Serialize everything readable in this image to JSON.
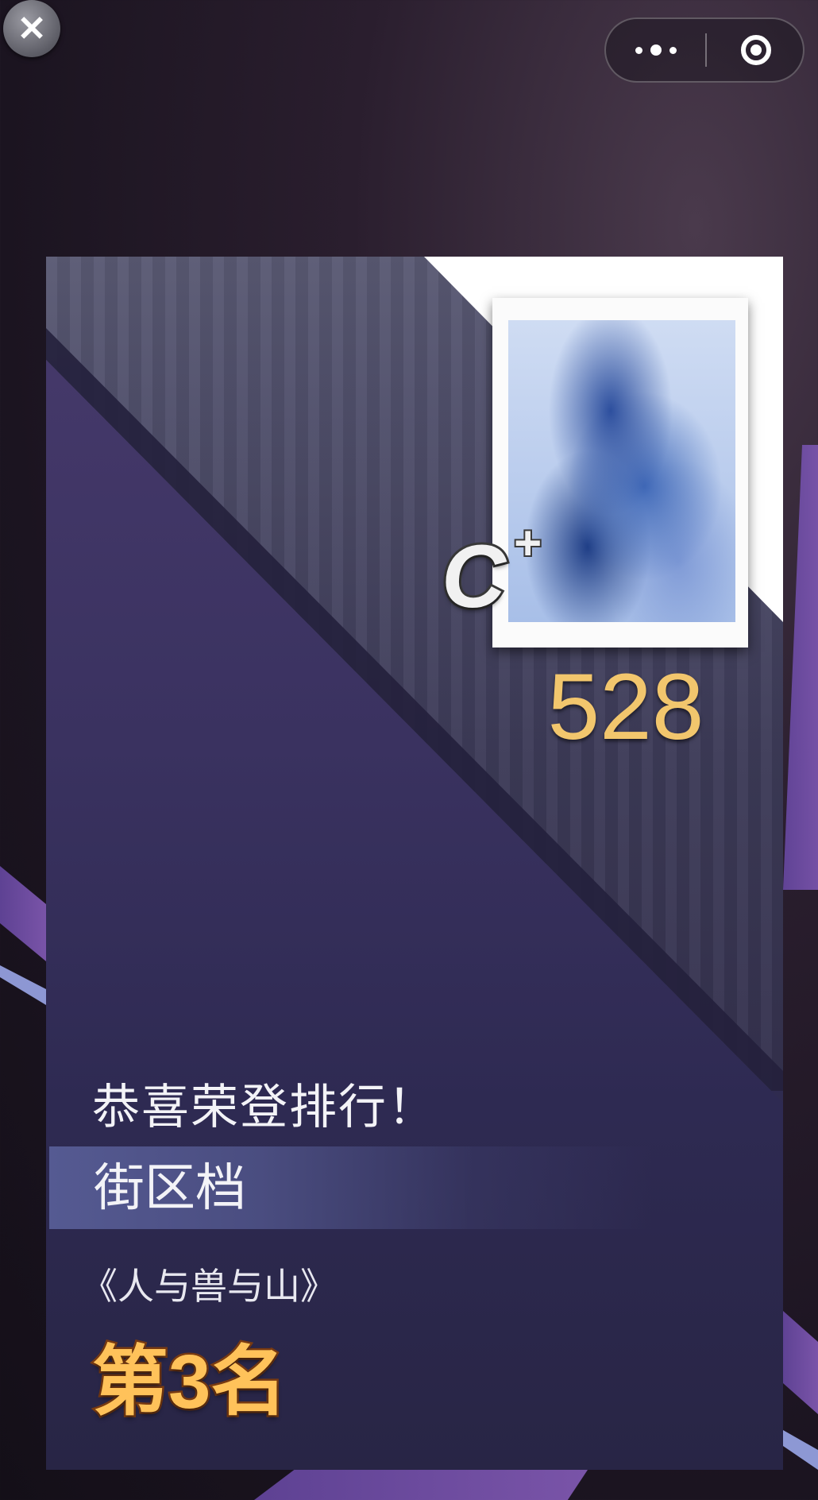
{
  "window": {
    "close_glyph": "✕"
  },
  "capsule": {
    "more_icon": "more-dots-icon",
    "target_icon": "target-circle-icon"
  },
  "card": {
    "grade": "C",
    "grade_modifier": "+",
    "score": "528",
    "congrats_text": "恭喜荣登排行！",
    "district": "街区档",
    "work_title": "《人与兽与山》",
    "rank": "第3名"
  },
  "colors": {
    "score": "#f2c66d",
    "rank": "#ffc25a",
    "card_bg": "#2f2b4f"
  }
}
